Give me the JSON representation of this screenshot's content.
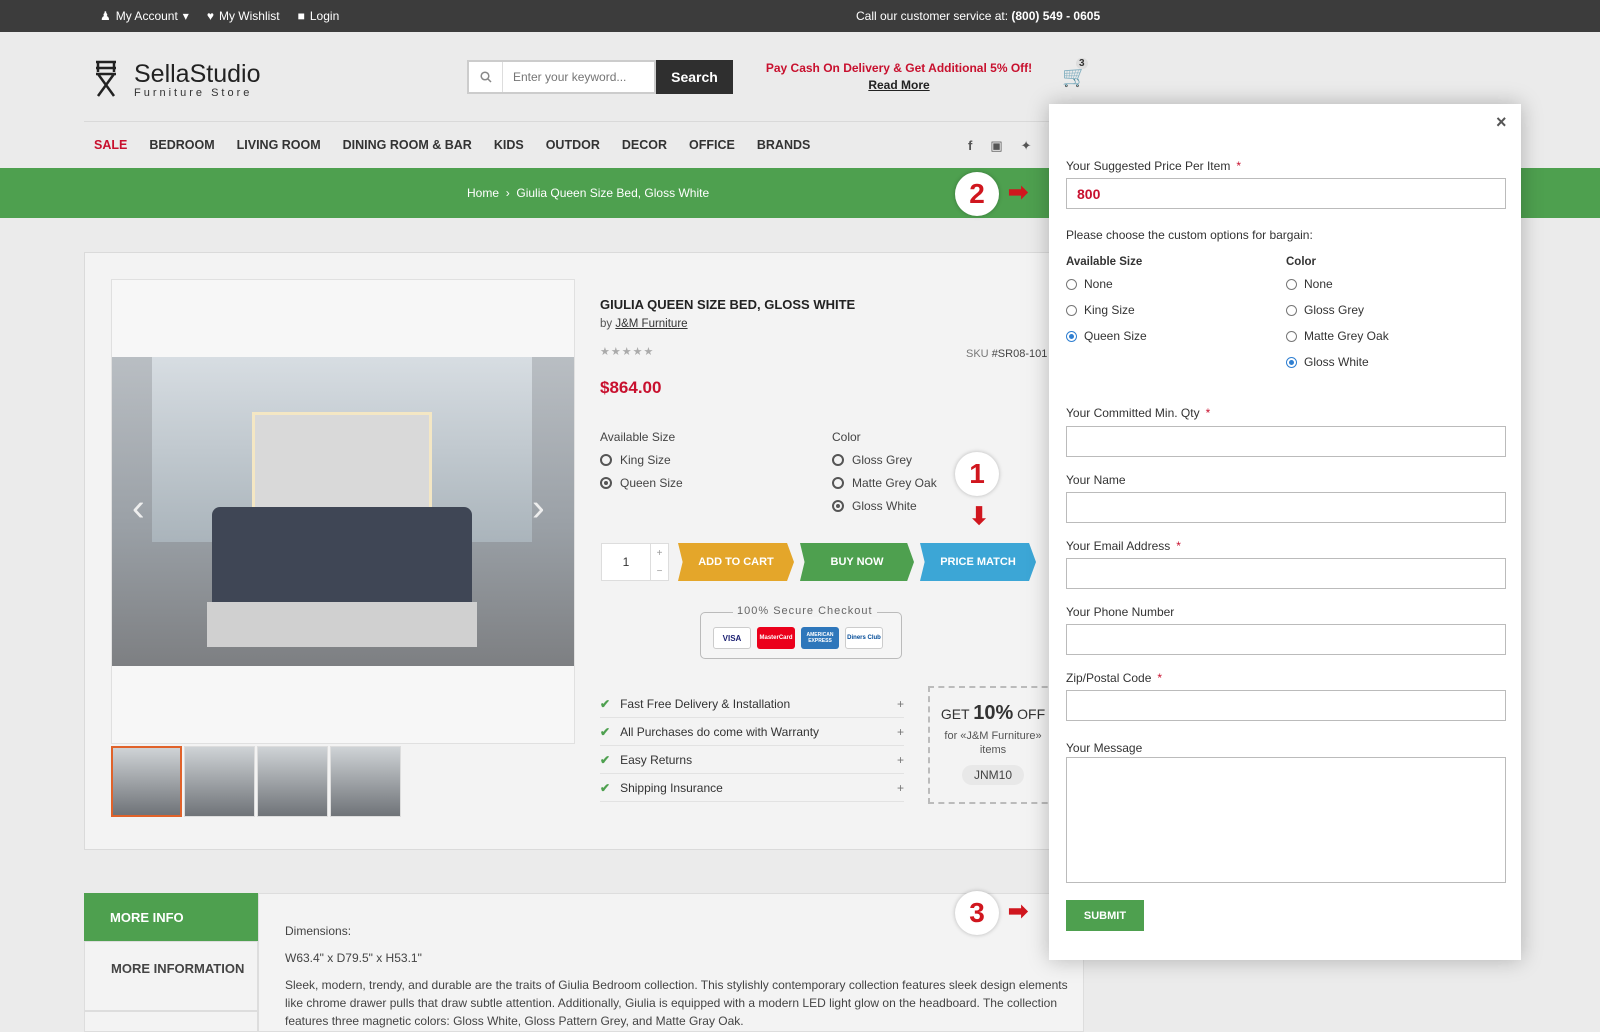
{
  "topbar": {
    "account": "My Account",
    "wishlist": "My Wishlist",
    "login": "Login",
    "service_prefix": "Call our customer service at: ",
    "service_phone": "(800) 549 - 0605"
  },
  "logo": {
    "name": "SellaStudio",
    "tagline": "Furniture Store"
  },
  "search": {
    "placeholder": "Enter your keyword...",
    "button": "Search"
  },
  "promo": {
    "line1": "Pay Cash On Delivery & Get Additional 5% Off!",
    "line2": "Read More"
  },
  "cart": {
    "count": "3"
  },
  "nav": [
    "SALE",
    "BEDROOM",
    "LIVING ROOM",
    "DINING ROOM & BAR",
    "KIDS",
    "OUTDOR",
    "DECOR",
    "OFFICE",
    "BRANDS"
  ],
  "breadcrumb": {
    "home": "Home",
    "sep": "›",
    "current": "Giulia Queen Size Bed, Gloss White"
  },
  "product": {
    "title": "GIULIA QUEEN SIZE BED, GLOSS WHITE",
    "by": "by ",
    "brand": "J&M Furniture",
    "stars": "★★★★★",
    "sku_label": "SKU ",
    "sku": "#SR08-101",
    "price": "$864.00",
    "size_label": "Available Size",
    "sizes": [
      {
        "label": "King Size",
        "selected": false
      },
      {
        "label": "Queen Size",
        "selected": true
      }
    ],
    "color_label": "Color",
    "colors": [
      {
        "label": "Gloss Grey",
        "selected": false
      },
      {
        "label": "Matte Grey Oak",
        "selected": false
      },
      {
        "label": "Gloss White",
        "selected": true
      }
    ],
    "qty": "1",
    "add_to_cart": "ADD TO CART",
    "buy_now": "BUY NOW",
    "price_match": "PRICE MATCH",
    "secure": "100% Secure Checkout",
    "cards": [
      "VISA",
      "MasterCard",
      "AMERICAN EXPRESS",
      "Diners Club"
    ],
    "features": [
      "Fast Free Delivery & Installation",
      "All Purchases do come with Warranty",
      "Easy Returns",
      "Shipping Insurance"
    ],
    "coupon": {
      "get": "GET ",
      "pct": "10%",
      "off": " OFF",
      "for": "for «J&M Furniture» items",
      "code": "JNM10"
    }
  },
  "tabs": {
    "more_info": "MORE INFO",
    "more_information": "MORE INFORMATION"
  },
  "description": {
    "dims_label": "Dimensions:",
    "dims": "W63.4\" x D79.5\" x H53.1\"",
    "text": "Sleek, modern, trendy, and durable are the traits of Giulia Bedroom collection.  This stylishly contemporary collection features sleek design elements like chrome drawer pulls that draw subtle attention. Additionally, Giulia is equipped with a modern LED light glow on the headboard. The collection features three magnetic colors: Gloss White, Gloss Pattern Grey, and Matte Gray Oak."
  },
  "annotations": [
    "1",
    "2",
    "3"
  ],
  "modal": {
    "close": "×",
    "price_label": "Your Suggested Price Per Item",
    "price_value": "800",
    "choose": "Please choose the custom options for bargain:",
    "size_head": "Available Size",
    "sizes": [
      {
        "label": "None",
        "selected": false
      },
      {
        "label": "King Size",
        "selected": false
      },
      {
        "label": "Queen Size",
        "selected": true
      }
    ],
    "color_head": "Color",
    "colors": [
      {
        "label": "None",
        "selected": false
      },
      {
        "label": "Gloss Grey",
        "selected": false
      },
      {
        "label": "Matte Grey Oak",
        "selected": false
      },
      {
        "label": "Gloss White",
        "selected": true
      }
    ],
    "min_qty": "Your Committed Min. Qty",
    "name": "Your Name",
    "email": "Your Email Address",
    "phone": "Your Phone Number",
    "zip": "Zip/Postal Code",
    "message": "Your Message",
    "required": "*",
    "submit": "SUBMIT"
  },
  "colors": {
    "green": "#4ea04f",
    "red": "#c8102e",
    "orange": "#e4a62a",
    "blue": "#3ca6d6",
    "dark": "#3c3c3c"
  }
}
